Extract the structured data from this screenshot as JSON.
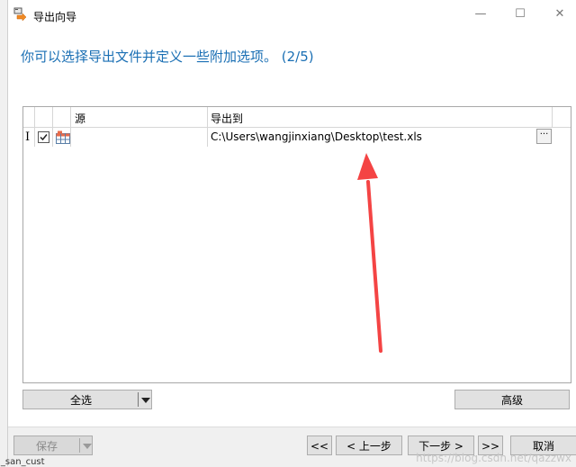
{
  "window": {
    "title": "导出向导",
    "minimize": "—",
    "maximize": "☐",
    "close": "✕"
  },
  "heading": "你可以选择导出文件并定义一些附加选项。 (2/5)",
  "grid": {
    "headers": {
      "source": "源",
      "export_to": "导出到"
    },
    "rows": [
      {
        "source": "",
        "export_to": "C:\\Users\\wangjinxiang\\Desktop\\test.xls",
        "checked": true,
        "cursor": "I",
        "browse": "···"
      }
    ]
  },
  "buttons": {
    "select_all": "全选",
    "advanced": "高级",
    "save": "保存",
    "first": "<<",
    "back": "< 上一步",
    "next": "下一步 >",
    "last": ">>",
    "cancel": "取消"
  },
  "watermark": "https://blog.csdn.net/qazzwx",
  "bottom_clip": "ol_san_cust"
}
